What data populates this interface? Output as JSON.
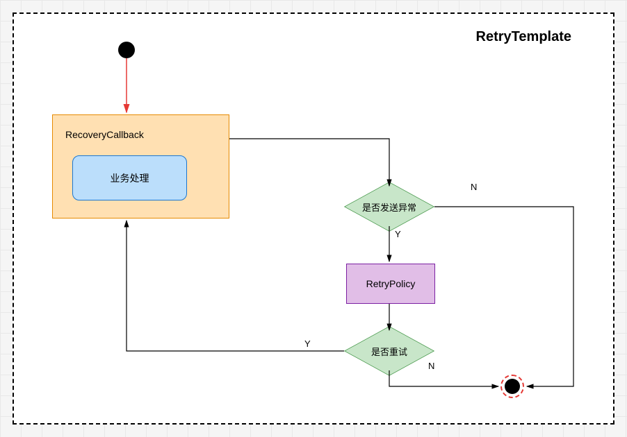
{
  "title": "RetryTemplate",
  "nodes": {
    "recovery_callback": "RecoveryCallback",
    "business_processing": "业务处理",
    "decision_exception": "是否发送异常",
    "retry_policy": "RetryPolicy",
    "decision_retry": "是否重试"
  },
  "labels": {
    "yes": "Y",
    "no": "N"
  }
}
